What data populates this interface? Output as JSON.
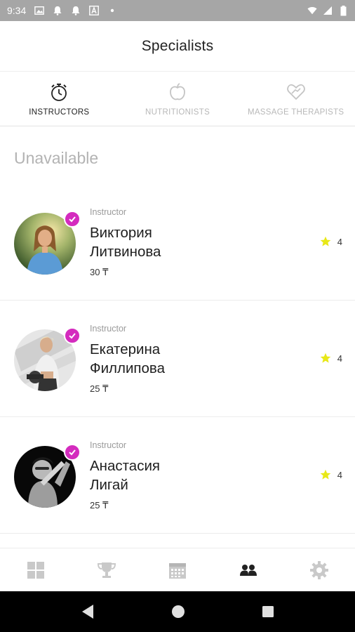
{
  "status_bar": {
    "time": "9:34",
    "left_icons": [
      "image-icon",
      "bell-icon",
      "bell-icon",
      "a-icon",
      "dot-icon"
    ],
    "right_icons": [
      "wifi-icon",
      "signal-icon",
      "battery-icon"
    ]
  },
  "header": {
    "title": "Specialists"
  },
  "tabs": [
    {
      "label": "INSTRUCTORS",
      "icon": "stopwatch-icon",
      "active": true
    },
    {
      "label": "NUTRITIONISTS",
      "icon": "apple-icon",
      "active": false
    },
    {
      "label": "MASSAGE THERAPISTS",
      "icon": "heart-hand-icon",
      "active": false
    }
  ],
  "section": {
    "title": "Unavailable"
  },
  "specialists": [
    {
      "role": "Instructor",
      "first_name": "Виктория",
      "last_name": "Литвинова",
      "price": "30 ₸",
      "rating": "4",
      "verified": true
    },
    {
      "role": "Instructor",
      "first_name": "Екатерина",
      "last_name": "Филлипова",
      "price": "25 ₸",
      "rating": "4",
      "verified": true
    },
    {
      "role": "Instructor",
      "first_name": "Анастасия",
      "last_name": "Лигай",
      "price": "25 ₸",
      "rating": "4",
      "verified": true
    }
  ],
  "bottom_nav": [
    {
      "icon": "dashboard-icon",
      "active": false
    },
    {
      "icon": "trophy-icon",
      "active": false
    },
    {
      "icon": "calendar-icon",
      "active": false
    },
    {
      "icon": "people-icon",
      "active": true
    },
    {
      "icon": "gear-icon",
      "active": false
    }
  ],
  "colors": {
    "accent": "#d42bbe",
    "star": "#e8e817",
    "status_bar": "#a6a6a6",
    "inactive": "#b8b8b8"
  }
}
